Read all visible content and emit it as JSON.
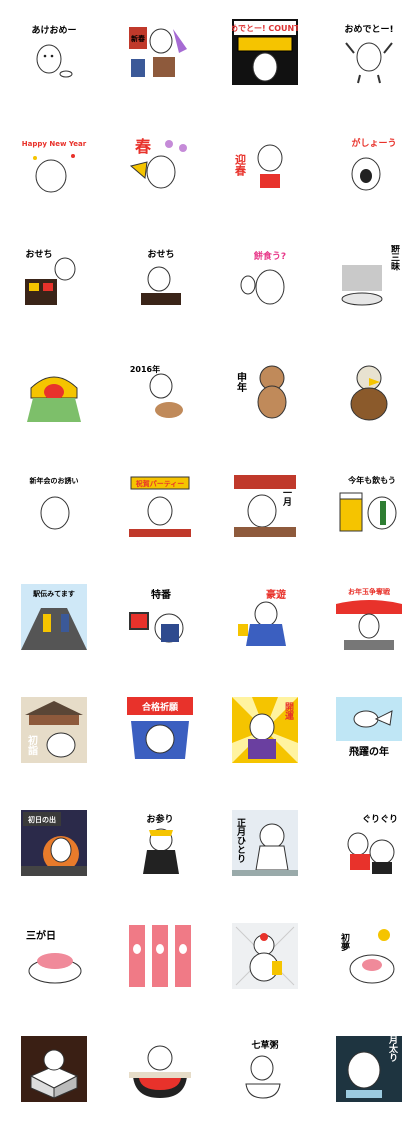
{
  "stickers": [
    {
      "caption": "あけおめー",
      "color": "#000000"
    },
    {
      "caption": "新春",
      "color": "#ffffff"
    },
    {
      "caption": "おめでとー! COUNT:0",
      "color": "#000000"
    },
    {
      "caption": "おめでとー!",
      "color": "#000000"
    },
    {
      "caption": "Happy New Year",
      "color": "#e8322b"
    },
    {
      "caption": "春",
      "color": "#e8322b"
    },
    {
      "caption": "迎春",
      "color": "#e8322b"
    },
    {
      "caption": "がしょーう",
      "color": "#e8322b"
    },
    {
      "caption": "おせち",
      "color": "#000000"
    },
    {
      "caption": "おせち",
      "color": "#000000"
    },
    {
      "caption": "餅食う?",
      "color": "#e83a8a"
    },
    {
      "caption": "餅三昧",
      "color": "#000000"
    },
    {
      "caption": "",
      "color": "#000000"
    },
    {
      "caption": "2016年",
      "color": "#000000"
    },
    {
      "caption": "申年",
      "color": "#000000"
    },
    {
      "caption": "",
      "color": "#000000"
    },
    {
      "caption": "新年会のお誘い",
      "color": "#000000"
    },
    {
      "caption": "祝賀パーティー",
      "color": "#e8322b"
    },
    {
      "caption": "一月",
      "color": "#000000"
    },
    {
      "caption": "今年も飲もう",
      "color": "#000000"
    },
    {
      "caption": "駅伝みてます",
      "color": "#000000"
    },
    {
      "caption": "特番",
      "color": "#000000"
    },
    {
      "caption": "豪遊",
      "color": "#e8322b"
    },
    {
      "caption": "お年玉争奪戦",
      "color": "#e8322b"
    },
    {
      "caption": "初詣",
      "color": "#ffffff"
    },
    {
      "caption": "合格祈願",
      "color": "#ffffff"
    },
    {
      "caption": "開運",
      "color": "#e8322b"
    },
    {
      "caption": "飛躍の年",
      "color": "#000000"
    },
    {
      "caption": "初日の出",
      "color": "#ffffff"
    },
    {
      "caption": "お参り",
      "color": "#000000"
    },
    {
      "caption": "正月ひとり",
      "color": "#000000"
    },
    {
      "caption": "ぐりぐり",
      "color": "#000000"
    },
    {
      "caption": "三が日",
      "color": "#000000"
    },
    {
      "caption": "",
      "color": "#000000"
    },
    {
      "caption": "",
      "color": "#000000"
    },
    {
      "caption": "初夢",
      "color": "#000000"
    },
    {
      "caption": "",
      "color": "#000000"
    },
    {
      "caption": "",
      "color": "#000000"
    },
    {
      "caption": "七草粥",
      "color": "#000000"
    },
    {
      "caption": "正月太り",
      "color": "#000000"
    }
  ]
}
